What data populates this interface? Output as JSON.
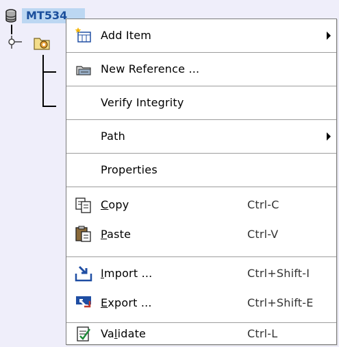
{
  "tree": {
    "root_label": "MT534",
    "root_icon": "database-icon",
    "child_icon": "folder-gear-icon"
  },
  "menu": {
    "items": [
      {
        "label": "Add Item",
        "icon": "add-item-icon",
        "submenu": true
      },
      {
        "label": "New Reference ...",
        "icon": "new-reference-icon"
      },
      {
        "label": "Verify Integrity"
      },
      {
        "label": "Path",
        "submenu": true
      },
      {
        "label": "Properties"
      },
      {
        "label_pre": "",
        "label_u": "C",
        "label_post": "opy",
        "icon": "copy-icon",
        "shortcut": "Ctrl-C"
      },
      {
        "label_pre": "",
        "label_u": "P",
        "label_post": "aste",
        "icon": "paste-icon",
        "shortcut": "Ctrl-V"
      },
      {
        "label_pre": "",
        "label_u": "I",
        "label_post": "mport ...",
        "icon": "import-icon",
        "shortcut": "Ctrl+Shift-I"
      },
      {
        "label_pre": "",
        "label_u": "E",
        "label_post": "xport ...",
        "icon": "export-icon",
        "shortcut": "Ctrl+Shift-E"
      },
      {
        "label_pre": "Va",
        "label_u": "l",
        "label_post": "idate",
        "icon": "validate-icon",
        "shortcut": "Ctrl-L"
      }
    ]
  }
}
